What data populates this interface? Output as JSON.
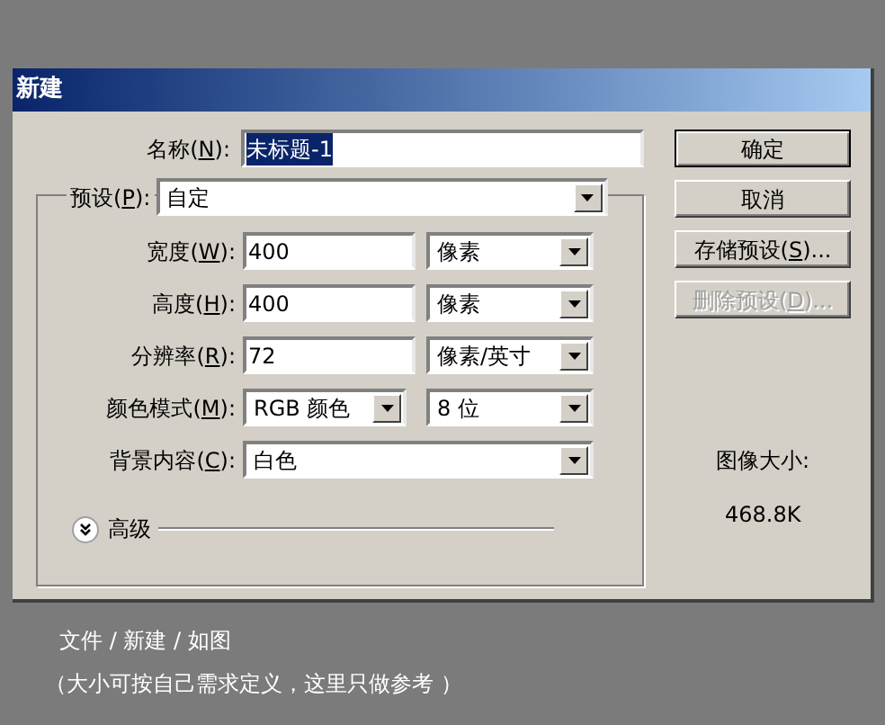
{
  "dialog": {
    "title": "新建",
    "name_field": {
      "label_before": "名称(",
      "mnemonic": "N",
      "label_after": "):",
      "value": "未标题-1",
      "text_selected": true
    },
    "preset": {
      "label_before": "预设(",
      "mnemonic": "P",
      "label_after": "):",
      "value": "自定"
    },
    "rows": [
      {
        "kind": "input_unit",
        "label_before": "宽度(",
        "mnemonic": "W",
        "label_after": "):",
        "value": "400",
        "unit": "像素"
      },
      {
        "kind": "input_unit",
        "label_before": "高度(",
        "mnemonic": "H",
        "label_after": "):",
        "value": "400",
        "unit": "像素"
      },
      {
        "kind": "input_unit",
        "label_before": "分辨率(",
        "mnemonic": "R",
        "label_after": "):",
        "value": "72",
        "unit": "像素/英寸"
      },
      {
        "kind": "two_selects",
        "label_before": "颜色模式(",
        "mnemonic": "M",
        "label_after": "):",
        "value": "RGB 颜色",
        "unit": "8 位"
      },
      {
        "kind": "wide_select",
        "label_before": "背景内容(",
        "mnemonic": "C",
        "label_after": "):",
        "value": "白色"
      }
    ],
    "advanced": {
      "label": "高级",
      "expanded": false
    },
    "buttons": [
      {
        "label_before": "确定",
        "default": true,
        "disabled": false
      },
      {
        "label_before": "取消",
        "default": false,
        "disabled": false
      },
      {
        "label_before": "存储预设(",
        "mnemonic": "S",
        "label_after": ")...",
        "default": false,
        "disabled": false
      },
      {
        "label_before": "删除预设(",
        "mnemonic": "D",
        "label_after": ")...",
        "default": false,
        "disabled": true
      }
    ],
    "image_size": {
      "label": "图像大小:",
      "value": "468.8K"
    }
  },
  "caption": [
    "文件 / 新建 / 如图",
    "（大小可按自己需求定义，这里只做参考 ）"
  ]
}
